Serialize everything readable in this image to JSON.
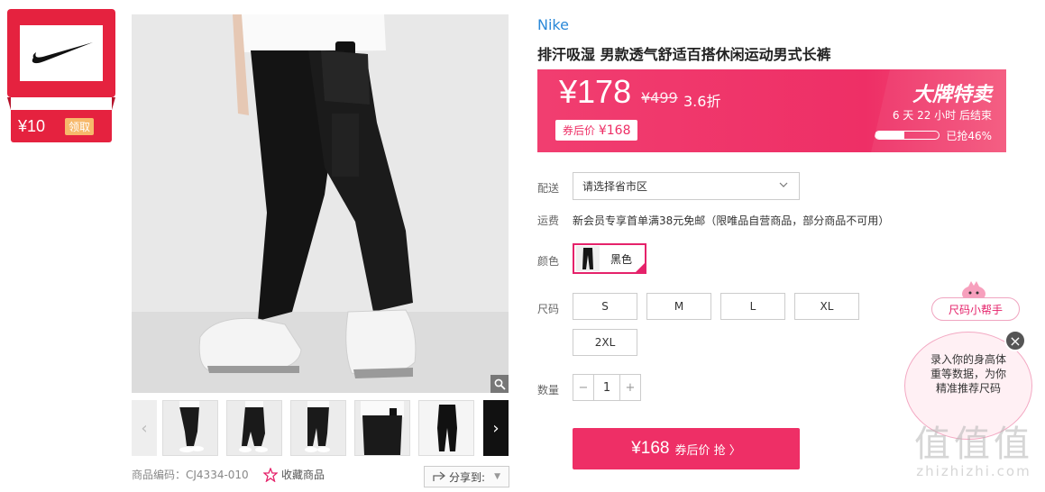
{
  "coupon": {
    "amount": "¥10",
    "claim_label": "领取",
    "brand_logo": "nike-swoosh-icon"
  },
  "gallery": {
    "zoom_icon": "magnifier-icon",
    "prev_arrow": "‹",
    "next_arrow": "›",
    "thumbnail_count": 6
  },
  "meta": {
    "product_code": "商品编码：CJ4334-010",
    "favorite_label": "收藏商品",
    "share_label": "分享到:"
  },
  "product": {
    "brand": "Nike",
    "title": "排汗吸湿 男款透气舒适百搭休闲运动男式长裤"
  },
  "price": {
    "current": "¥178",
    "original": "¥499",
    "discount": "3.6折",
    "after_coupon_label": "券后价",
    "after_coupon_value": "¥168"
  },
  "flash_sale": {
    "title": "大牌特卖",
    "countdown": "6 天 22 小时 后结束",
    "sold_text": "已抢46%",
    "sold_fraction": 0.46
  },
  "delivery": {
    "label": "配送",
    "placeholder": "请选择省市区"
  },
  "shipping": {
    "label": "运费",
    "text": "新会员专享首单满38元免邮（限唯品自营商品，部分商品不可用）"
  },
  "color": {
    "label": "颜色",
    "selected": "黑色"
  },
  "size": {
    "label": "尺码",
    "options": [
      "S",
      "M",
      "L",
      "XL",
      "2XL"
    ]
  },
  "quantity": {
    "label": "数量",
    "value": "1",
    "minus": "−",
    "plus": "+"
  },
  "buy": {
    "price": "¥168",
    "text": "券后价 抢 〉"
  },
  "size_helper": {
    "tag": "尺码小帮手",
    "line1": "录入你的身高体",
    "line2": "重等数据，为你",
    "line3": "精准推荐尺码",
    "close": "×"
  },
  "watermark": {
    "big": "值值值",
    "small": "zhizhizhi.com"
  },
  "colors": {
    "accent": "#ee2f66",
    "coupon_red": "#e5223f",
    "brand_blue": "#2a88d8"
  }
}
